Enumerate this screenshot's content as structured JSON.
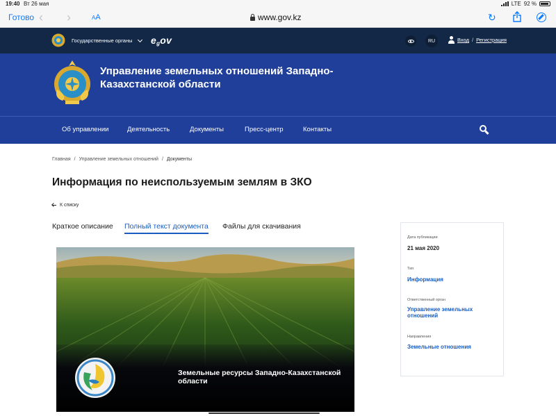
{
  "status_bar": {
    "time": "19:40",
    "date": "Вт 26 мая",
    "network": "LTE",
    "battery": "92 %",
    "battery_level": 0.92
  },
  "browser": {
    "done_label": "Готово",
    "text_size_label_small": "A",
    "text_size_label_large": "A",
    "url": "www.gov.kz",
    "back_icon": "chevron-left-icon",
    "forward_icon": "chevron-right-icon",
    "reload_icon": "reload-icon",
    "share_icon": "share-icon",
    "compass_icon": "compass-icon"
  },
  "topbar": {
    "gov_organs_label": "Государственные органы",
    "egov_prefix": "e",
    "egov_sub": "g",
    "egov_suffix": "ov",
    "lang_label": "RU",
    "login_label": "Вход",
    "login_sep": "/",
    "register_label": "Регистрация"
  },
  "header": {
    "title": "Управление земельных отношений Западно-Казахстанской области"
  },
  "nav": {
    "items": [
      {
        "label": "Об управлении"
      },
      {
        "label": "Деятельность"
      },
      {
        "label": "Документы"
      },
      {
        "label": "Пресс-центр"
      },
      {
        "label": "Контакты"
      }
    ]
  },
  "breadcrumb": {
    "items": [
      "Главная",
      "Управление земельных отношений",
      "Документы"
    ],
    "separator": "/"
  },
  "page": {
    "title": "Информация по неиспользуемым землям в ЗКО",
    "back_label": "К списку"
  },
  "tabs": [
    {
      "label": "Краткое описание",
      "active": false
    },
    {
      "label": "Полный текст документа",
      "active": true
    },
    {
      "label": "Файлы для скачивания",
      "active": false
    }
  ],
  "document": {
    "caption": "Земельные ресурсы Западно-Казахстанской области"
  },
  "info_card": {
    "publication_date_label": "Дата публикации",
    "publication_date": "21 мая 2020",
    "type_label": "Тип",
    "type_value": "Информация",
    "responsible_label": "Ответственный орган",
    "responsible_value": "Управление земельных отношений",
    "directions_label": "Направления",
    "directions_value": "Земельные отношения"
  },
  "colors": {
    "topbar_bg": "#132846",
    "header_bg": "#1f3f9a",
    "link": "#1b5dbf",
    "ios_blue": "#0a7aff"
  }
}
